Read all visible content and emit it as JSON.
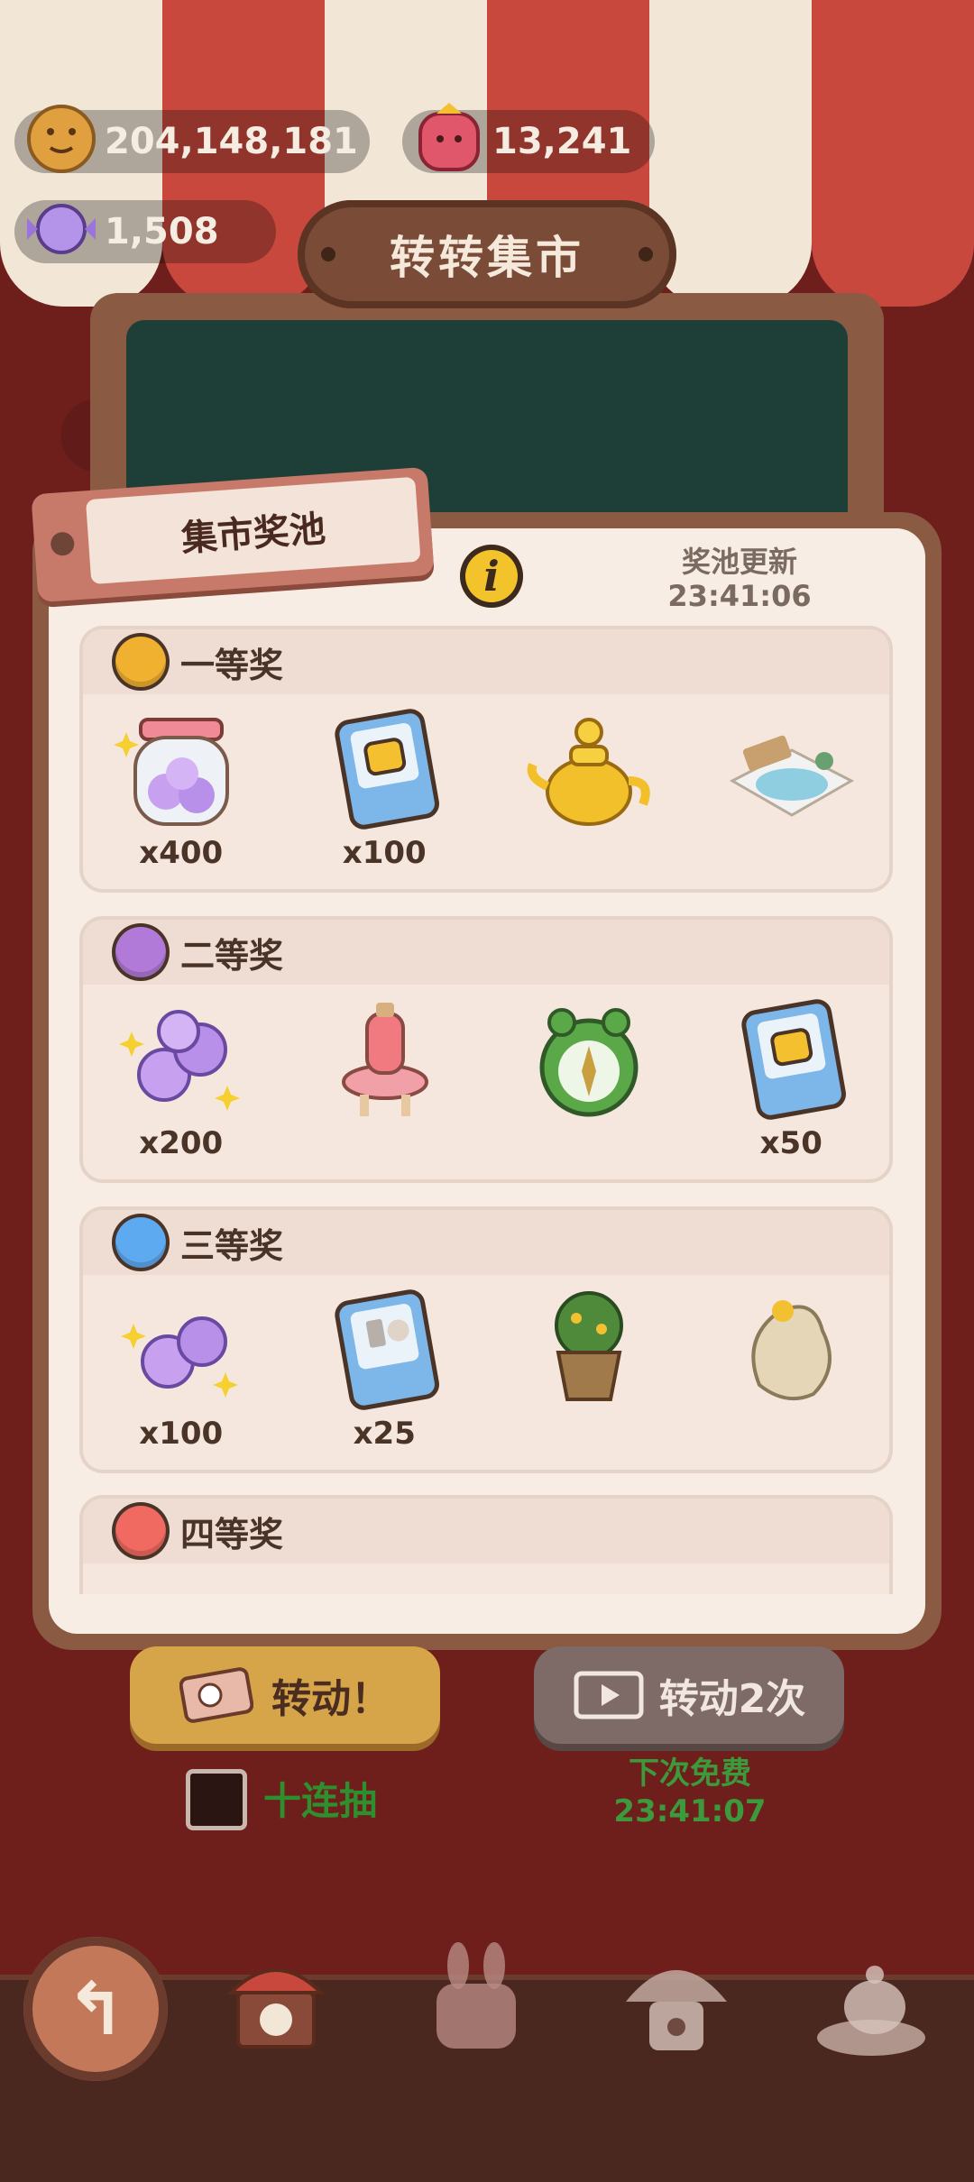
{
  "currencies": {
    "cookies": "204,148,181",
    "gems": "13,241",
    "candy": "1,508"
  },
  "market_title": "转转集市",
  "modal": {
    "tag_title": "集市奖池",
    "info_icon": "i",
    "refresh_label": "奖池更新",
    "refresh_time": "23:41:06",
    "tiers": [
      {
        "name": "一等奖",
        "color": "#f0b030",
        "items": [
          {
            "icon": "candy-jar-icon",
            "qty": "x400"
          },
          {
            "icon": "fist-card-icon",
            "qty": "x100"
          },
          {
            "icon": "golden-teapot-icon",
            "qty": ""
          },
          {
            "icon": "snow-hotspring-icon",
            "qty": ""
          }
        ]
      },
      {
        "name": "二等奖",
        "color": "#b27ad8",
        "items": [
          {
            "icon": "candy-bundle-icon",
            "qty": "x200"
          },
          {
            "icon": "potion-stand-icon",
            "qty": ""
          },
          {
            "icon": "frog-compass-icon",
            "qty": ""
          },
          {
            "icon": "fist-card-icon",
            "qty": "x50"
          }
        ]
      },
      {
        "name": "三等奖",
        "color": "#5eaaf0",
        "items": [
          {
            "icon": "candy-bundle-icon",
            "qty": "x100"
          },
          {
            "icon": "tool-card-icon",
            "qty": "x25"
          },
          {
            "icon": "potted-plant-icon",
            "qty": ""
          },
          {
            "icon": "ghost-creature-icon",
            "qty": ""
          }
        ]
      },
      {
        "name": "四等奖",
        "color": "#f06a62",
        "items": []
      }
    ]
  },
  "controls": {
    "spin_label": "转动！",
    "spin_twice_label": "转动2次",
    "ten_draw_label": "十连抽",
    "free_label": "下次免费",
    "free_time": "23:41:07"
  },
  "nav": {
    "back_icon": "back-arrow-icon",
    "items": [
      "carousel-icon",
      "bunny-house-icon",
      "mushroom-house-icon",
      "tea-set-icon"
    ]
  }
}
